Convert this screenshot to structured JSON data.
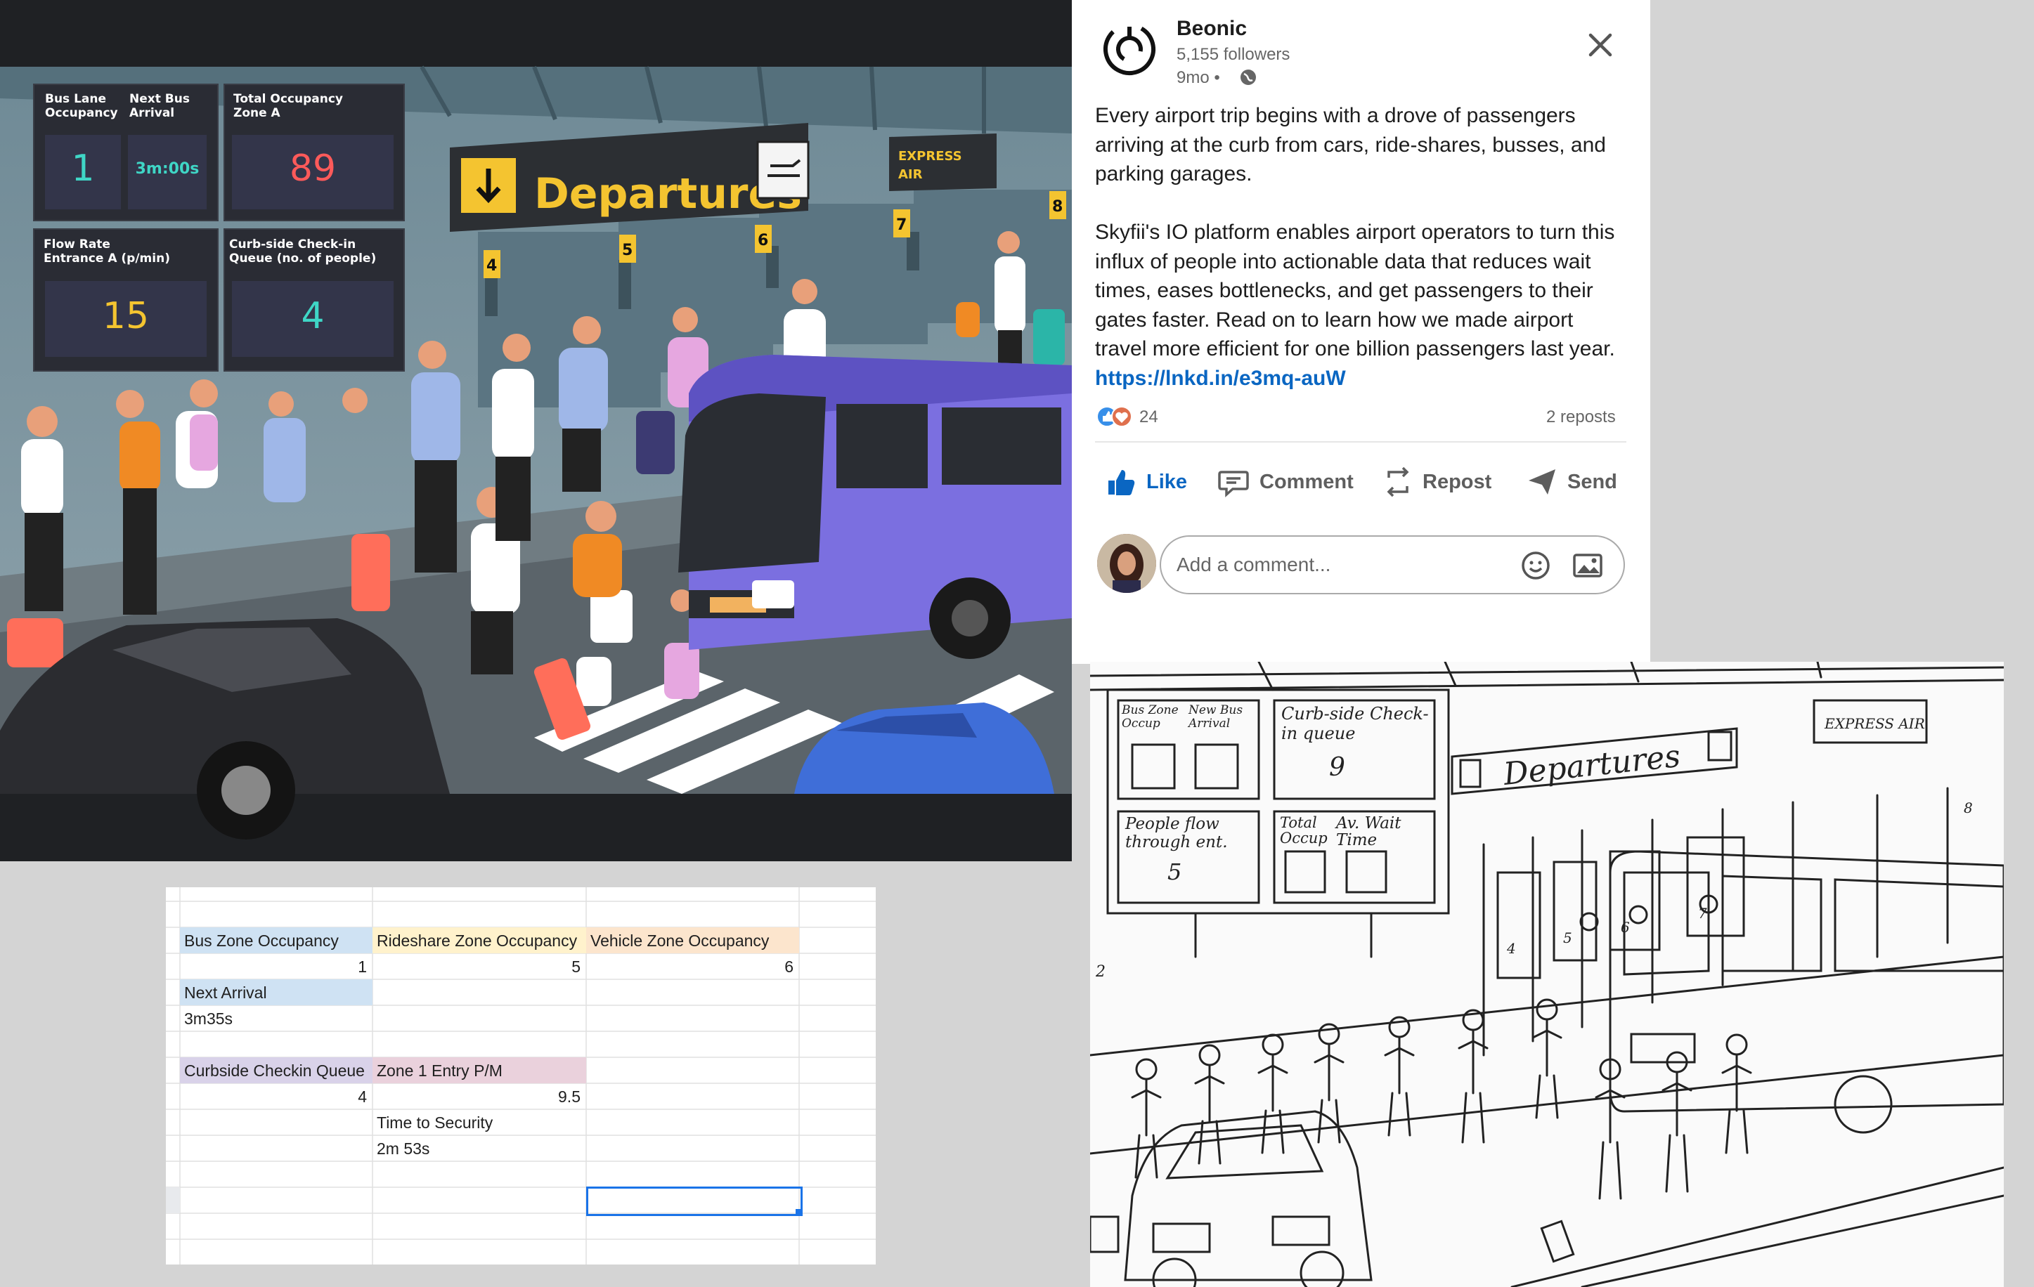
{
  "illustration": {
    "dashboard": {
      "bus_lane": {
        "label_1": "Bus Lane",
        "label_2": "Occupancy",
        "value": "1"
      },
      "next_bus": {
        "label_1": "Next Bus",
        "label_2": "Arrival",
        "value": "3m:00s"
      },
      "total_occupancy": {
        "label_1": "Total Occupancy",
        "label_2": "Zone A",
        "value": "89"
      },
      "flow_rate": {
        "label_1": "Flow Rate",
        "label_2": "Entrance A (p/min)",
        "value": "15"
      },
      "curbside": {
        "label_1": "Curb-side Check-in",
        "label_2": "Queue (no. of people)",
        "value": "4"
      }
    },
    "departures_sign": "Departures",
    "express_air": {
      "line_1": "EXPRESS",
      "line_2": "AIR"
    },
    "gate_numbers": [
      "4",
      "5",
      "6",
      "7",
      "8"
    ],
    "colors": {
      "sign_yellow": "#f4c430",
      "bus_purple": "#7b6fe0",
      "value_cyan": "#3fd6c6",
      "value_red": "#ff5a5a",
      "value_yellow": "#f4c430"
    }
  },
  "post": {
    "company": "Beonic",
    "followers": "5,155 followers",
    "age": "9mo •",
    "paragraph_1": "Every airport trip begins with a drove of passengers arriving at the curb from cars, ride-shares, busses, and parking garages.",
    "paragraph_2": "Skyfii's IO platform enables airport operators to turn this influx of people into actionable data that reduces wait times, eases bottlenecks, and get passengers to their gates faster. Read on to learn how we made airport travel more efficient for one billion passengers last year.",
    "link": "https://lnkd.in/e3mq-auW",
    "reaction_count": "24",
    "reposts": "2 reposts",
    "actions": {
      "like": "Like",
      "comment": "Comment",
      "repost": "Repost",
      "send": "Send"
    },
    "comment_placeholder": "Add a comment...",
    "icons": [
      "beonic-logo-icon",
      "close-icon",
      "globe-icon",
      "thumbs-up-icon",
      "comment-icon",
      "repost-icon",
      "send-icon",
      "emoji-icon",
      "image-icon"
    ],
    "colors": {
      "link": "#0a66c2",
      "like_blue": "#0a66c2"
    }
  },
  "sheet": {
    "header_1": [
      "Bus Zone Occupancy",
      "Rideshare Zone Occupancy",
      "Vehicle Zone Occupancy"
    ],
    "values_1": [
      "1",
      "5",
      "6"
    ],
    "next_arrival_label": "Next Arrival",
    "next_arrival_value": "3m35s",
    "header_2": [
      "Curbside Checkin Queue",
      "Zone 1 Entry P/M"
    ],
    "values_2": [
      "4",
      "9.5"
    ],
    "time_to_security_label": "Time to Security",
    "time_to_security_value": "2m 53s",
    "colors": {
      "blue": "#cfe2f3",
      "yellow": "#fff2cc",
      "orange": "#fce5cd",
      "purple": "#d9d2e9",
      "pink": "#ead1dc"
    }
  },
  "sketch": {
    "cells": {
      "bus_zone": "Bus Zone Occup",
      "new_bus": "New Bus Arrival",
      "curb": "Curb-side Check-in queue",
      "curb_value": "9",
      "people_flow": "People flow through ent.",
      "people_flow_value": "5",
      "total_occ": "Total Occup",
      "avg_wait": "Av. Wait Time"
    },
    "departures": "Departures",
    "express": "EXPRESS AIR",
    "gate_numbers": [
      "4",
      "5",
      "6",
      "7",
      "8",
      "2"
    ]
  }
}
